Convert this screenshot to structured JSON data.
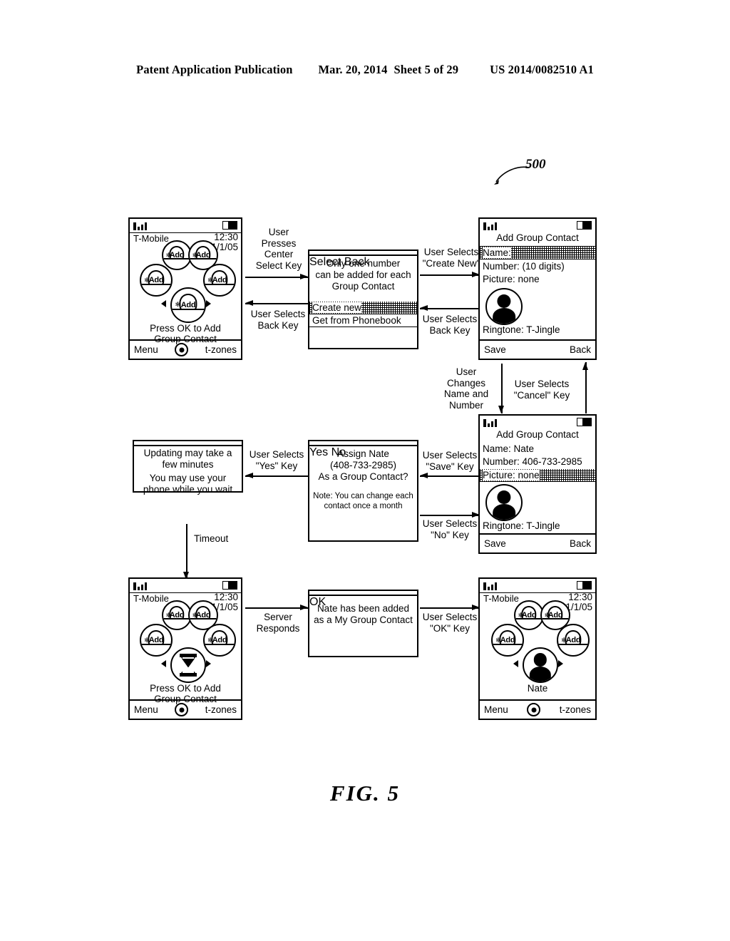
{
  "header": {
    "publication": "Patent Application Publication",
    "date": "Mar. 20, 2014",
    "sheet": "Sheet 5 of 29",
    "patent_number": "US 2014/0082510 A1"
  },
  "figure": {
    "caption": "FIG.  5",
    "reference_numeral": "500"
  },
  "common": {
    "carrier": "T-Mobile",
    "time": "12:30",
    "date": "1/1/05",
    "menu_label": "Menu",
    "tzones_label": "t-zones",
    "add_label": "Add",
    "press_ok_line1": "Press OK to Add",
    "press_ok_line2": "Group Contact"
  },
  "screens": {
    "home_empty": {
      "name": "home-empty-screen",
      "carrier": "T-Mobile",
      "time": "12:30",
      "date": "1/1/05",
      "bubbles": [
        "Add",
        "Add",
        "Add",
        "Add",
        "Add"
      ],
      "hint_line1": "Press OK to Add",
      "hint_line2": "Group Contact",
      "softkey_left": "Menu",
      "softkey_right": "t-zones"
    },
    "source_menu": {
      "name": "number-source-menu",
      "message_line1": "Only one number",
      "message_line2": "can be added for each",
      "message_line3": "Group Contact",
      "options": [
        {
          "label": "Create new",
          "selected": true
        },
        {
          "label": "Get from Phonebook",
          "selected": false
        }
      ],
      "softkey_left": "Select",
      "softkey_right": "Back"
    },
    "add_contact_empty": {
      "name": "add-group-contact-empty",
      "title": "Add Group Contact",
      "fields": [
        {
          "label": "Name:",
          "value": "",
          "highlighted": true
        },
        {
          "label": "Number:",
          "value": "(10 digits)",
          "highlighted": false
        },
        {
          "label": "Picture:",
          "value": "none",
          "highlighted": false
        }
      ],
      "ringtone_label": "Ringtone: T-Jingle",
      "softkey_left": "Save",
      "softkey_right": "Back"
    },
    "add_contact_filled": {
      "name": "add-group-contact-filled",
      "title": "Add Group Contact",
      "fields": [
        {
          "label": "Name:",
          "value": "Nate",
          "highlighted": false
        },
        {
          "label": "Number:",
          "value": "406-733-2985",
          "highlighted": false
        },
        {
          "label": "Picture:",
          "value": "none",
          "highlighted": true
        }
      ],
      "ringtone_label": "Ringtone: T-Jingle",
      "softkey_left": "Save",
      "softkey_right": "Back"
    },
    "assign_confirm": {
      "name": "assign-contact-confirm-dialog",
      "line1": "Assign Nate",
      "line2": "(408-733-2985)",
      "line3": "As a Group Contact?",
      "note_line1": "Note: You can change each",
      "note_line2": "contact once a month",
      "softkey_left": "Yes",
      "softkey_right": "No"
    },
    "updating": {
      "name": "updating-progress-dialog",
      "line1": "Updating may take a",
      "line2": "few minutes",
      "line3": "You may use your",
      "line4": "phone while you wait"
    },
    "home_waiting": {
      "name": "home-waiting-screen",
      "carrier": "T-Mobile",
      "time": "12:30",
      "date": "1/1/05",
      "bubbles": [
        "Add",
        "Add",
        "Add",
        "Add"
      ],
      "center_icon": "hourglass-icon",
      "hint_line1": "Press OK to Add",
      "hint_line2": "Group Contact",
      "softkey_left": "Menu",
      "softkey_right": "t-zones"
    },
    "added_confirm": {
      "name": "contact-added-dialog",
      "line1": "Nate has been added",
      "line2": "as a My Group Contact",
      "softkey_left": "OK"
    },
    "home_with_contact": {
      "name": "home-with-contact-screen",
      "carrier": "T-Mobile",
      "time": "12:30",
      "date": "1/1/05",
      "bubbles": [
        "Add",
        "Add",
        "Add",
        "Add"
      ],
      "center_contact_name": "Nate",
      "softkey_left": "Menu",
      "softkey_right": "t-zones"
    }
  },
  "transitions": {
    "press_center_select": {
      "line1": "User",
      "line2": "Presses",
      "line3": "Center",
      "line4": "Select Key"
    },
    "back_key_1": {
      "line1": "User Selects",
      "line2": "Back Key"
    },
    "create_new": {
      "line1": "User Selects",
      "line2": "\"Create New\""
    },
    "back_key_2": {
      "line1": "User Selects",
      "line2": "Back Key"
    },
    "changes_name_number": {
      "line1": "User",
      "line2": "Changes",
      "line3": "Name and",
      "line4": "Number"
    },
    "cancel_key": {
      "line1": "User Selects",
      "line2": "\"Cancel\" Key"
    },
    "save_key": {
      "line1": "User Selects",
      "line2": "\"Save\" Key"
    },
    "no_key": {
      "line1": "User Selects",
      "line2": "\"No\" Key"
    },
    "yes_key": {
      "line1": "User Selects",
      "line2": "\"Yes\" Key"
    },
    "timeout": {
      "line1": "Timeout"
    },
    "server_responds": {
      "line1": "Server",
      "line2": "Responds"
    },
    "ok_key": {
      "line1": "User Selects",
      "line2": "\"OK\" Key"
    }
  }
}
